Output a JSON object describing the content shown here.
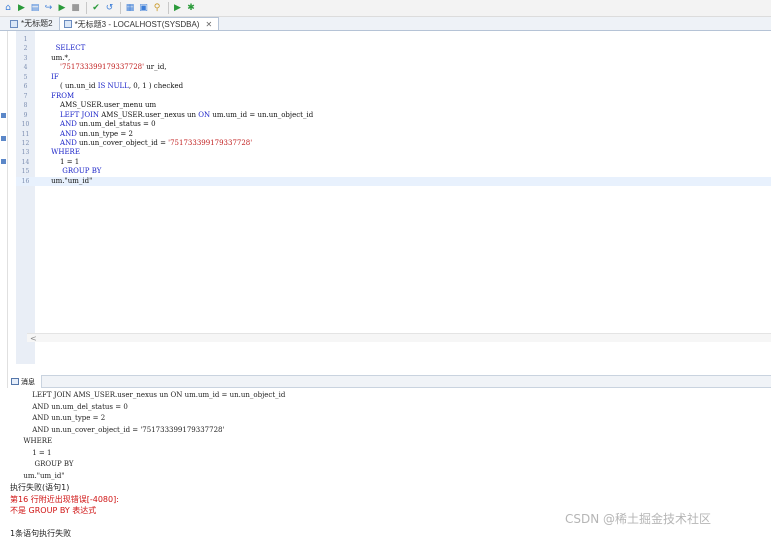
{
  "toolbar": {
    "buttons": [
      {
        "name": "home-icon",
        "glyph": "⌂",
        "color": "#3b7dd8"
      },
      {
        "name": "run-icon",
        "glyph": "▶",
        "color": "#2a9a3a"
      },
      {
        "name": "run-script-icon",
        "glyph": "▤",
        "color": "#3b7dd8"
      },
      {
        "name": "step-icon",
        "glyph": "↪",
        "color": "#3b7dd8"
      },
      {
        "name": "run-selection-icon",
        "glyph": "▶",
        "color": "#2a9a3a"
      },
      {
        "name": "stop-icon",
        "glyph": "■",
        "color": "#9a9a9a"
      },
      {
        "name": "commit-icon",
        "glyph": "✔",
        "color": "#2a9a3a"
      },
      {
        "name": "rollback-icon",
        "glyph": "↺",
        "color": "#3b7dd8"
      },
      {
        "name": "format-icon",
        "glyph": "▦",
        "color": "#3b7dd8"
      },
      {
        "name": "explain-icon",
        "glyph": "▣",
        "color": "#3b7dd8"
      },
      {
        "name": "search-icon",
        "glyph": "⚲",
        "color": "#c99a2a"
      },
      {
        "name": "debug-step-icon",
        "glyph": "▶",
        "color": "#2a9a3a"
      },
      {
        "name": "debug-icon",
        "glyph": "✱",
        "color": "#2a9a3a"
      }
    ]
  },
  "tabs": [
    {
      "label": "*无标题2",
      "active": false
    },
    {
      "label": "*无标题3 - LOCALHOST(SYSDBA)",
      "active": true,
      "close": "✕"
    }
  ],
  "editor": {
    "lines": [
      {
        "num": "1",
        "indent": "",
        "segments": []
      },
      {
        "num": "2",
        "indent": "       ",
        "segments": [
          {
            "t": "SELECT",
            "c": "kw"
          }
        ]
      },
      {
        "num": "3",
        "indent": "     ",
        "segments": [
          {
            "t": "um.*,",
            "c": ""
          }
        ]
      },
      {
        "num": "4",
        "indent": "         ",
        "segments": [
          {
            "t": "'751733399179337728'",
            "c": "str"
          },
          {
            "t": " ur_id,",
            "c": ""
          }
        ]
      },
      {
        "num": "5",
        "indent": "     ",
        "segments": [
          {
            "t": "IF",
            "c": "kw"
          }
        ]
      },
      {
        "num": "6",
        "indent": "         ",
        "segments": [
          {
            "t": "( un.un_id ",
            "c": ""
          },
          {
            "t": "IS NULL",
            "c": "kw"
          },
          {
            "t": ", 0, 1 ) checked",
            "c": ""
          }
        ]
      },
      {
        "num": "7",
        "indent": "     ",
        "segments": [
          {
            "t": "FROM",
            "c": "kw"
          }
        ]
      },
      {
        "num": "8",
        "indent": "         ",
        "segments": [
          {
            "t": "AMS_USER.user_menu um",
            "c": ""
          }
        ]
      },
      {
        "num": "9",
        "indent": "         ",
        "segments": [
          {
            "t": "LEFT JOIN",
            "c": "kw"
          },
          {
            "t": " AMS_USER.user_nexus un ",
            "c": ""
          },
          {
            "t": "ON",
            "c": "kw"
          },
          {
            "t": " um.um_id = un.un_object_id",
            "c": ""
          }
        ]
      },
      {
        "num": "10",
        "indent": "         ",
        "segments": [
          {
            "t": "AND",
            "c": "kw"
          },
          {
            "t": " un.um_del_status = 0",
            "c": ""
          }
        ]
      },
      {
        "num": "11",
        "indent": "         ",
        "segments": [
          {
            "t": "AND",
            "c": "kw"
          },
          {
            "t": " un.un_type = 2",
            "c": ""
          }
        ]
      },
      {
        "num": "12",
        "indent": "         ",
        "segments": [
          {
            "t": "AND",
            "c": "kw"
          },
          {
            "t": " un.un_cover_object_id = ",
            "c": ""
          },
          {
            "t": "'751733399179337728'",
            "c": "str"
          }
        ]
      },
      {
        "num": "13",
        "indent": "     ",
        "segments": [
          {
            "t": "WHERE",
            "c": "kw"
          }
        ]
      },
      {
        "num": "14",
        "indent": "         ",
        "segments": [
          {
            "t": "1 = 1",
            "c": ""
          }
        ]
      },
      {
        "num": "15",
        "indent": "          ",
        "segments": [
          {
            "t": "GROUP BY",
            "c": "kw"
          }
        ]
      },
      {
        "num": "16",
        "indent": "     ",
        "segments": [
          {
            "t": "um.\"um_id\"",
            "c": ""
          }
        ],
        "current": true
      }
    ],
    "scroll_arrow": "<"
  },
  "output_panel": {
    "tab_label": "消息",
    "lines": [
      {
        "text": "          LEFT JOIN AMS_USER.user_nexus un ON um.um_id = un.un_object_id",
        "style": ""
      },
      {
        "text": "          AND un.um_del_status = 0",
        "style": ""
      },
      {
        "text": "          AND un.un_type = 2",
        "style": ""
      },
      {
        "text": "          AND un.un_cover_object_id = '751733399179337728'",
        "style": ""
      },
      {
        "text": "      WHERE",
        "style": ""
      },
      {
        "text": "          1 = 1",
        "style": ""
      },
      {
        "text": "           GROUP BY",
        "style": ""
      },
      {
        "text": "      um.\"um_id\"",
        "style": ""
      },
      {
        "text": "执行失败(语句1)",
        "style": "cjk"
      },
      {
        "text": "第16 行附近出现错误[-4080]:",
        "style": "err cjk"
      },
      {
        "text": "不是 GROUP BY 表达式",
        "style": "err cjk"
      },
      {
        "text": "",
        "style": ""
      },
      {
        "text": "1条语句执行失败",
        "style": "cjk"
      }
    ]
  },
  "watermark": "CSDN @稀土掘金技术社区"
}
